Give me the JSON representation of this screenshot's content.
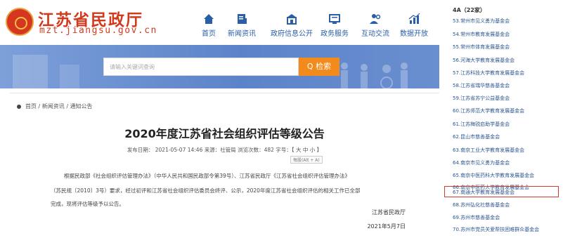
{
  "header": {
    "site_name": "江苏省民政厅",
    "site_url": "mzt.jiangsu.gov.cn",
    "nav": [
      {
        "label": "首页",
        "icon": "home-icon"
      },
      {
        "label": "新闻资讯",
        "icon": "news-icon"
      },
      {
        "label": "政府信息公开",
        "icon": "building-icon"
      },
      {
        "label": "政务服务",
        "icon": "monitor-icon"
      },
      {
        "label": "互动交流",
        "icon": "people-icon"
      },
      {
        "label": "数据开放",
        "icon": "chart-icon"
      }
    ]
  },
  "search": {
    "placeholder": "请输入关键词查询",
    "button_label": "Q 检索"
  },
  "breadcrumb": "首页 / 新闻资讯 / 通知公告",
  "article": {
    "title": "2020年度江苏省社会组织评估等级公告",
    "meta": "发布日期： 2021-05-07 14:46  来源：社管局   浏览次数：482   字号：【 大 中 小 】",
    "tooltip": "每股(Alt + A)",
    "paragraph_lines": [
      "根据民政部《社会组织评估管理办法》（中华人民共和国民政部令第39号）、江苏省民政厅《江苏省社会组织评估管理办法》",
      "（苏民规〔2010〕3号）要求，经过初评和江苏省社会组织评估委员会终评、公示，2020年度江苏省社会组织评估的相关工作已全部",
      "完成，现将评估等级予以公告。"
    ],
    "signature_org": "江苏省民政厅",
    "signature_date": "2021年5月7日"
  },
  "sidebar": {
    "heading": "4A（22家）",
    "items": [
      "53.常州市见义勇为基金会",
      "54.常州市教育发展基金会",
      "55.常州市体育发展基金会",
      "56.河海大学教育发展基金会",
      "57.江苏科技大学教育发展基金会",
      "58.江苏省瑞华慈善基金会",
      "59.江苏省苏宁公益基金会",
      "60.江苏师范大学教育发展基金会",
      "61.江苏梅锐启助学基金会",
      "62.昆山市慈善基金会",
      "63.南京工业大学教育发展基金会",
      "64.南京市见义勇为基金会",
      "65.南京中医药科大学教育发展基金会",
      "66.南京中医药大学教育发展基金会",
      "67.南通大学教育发展基金会",
      "68.苏州弘化社慈善基金会",
      "69.苏州市慈善基金会",
      "70.苏州市党员关爱帮扶困难群众基金会"
    ],
    "highlighted_index": 14,
    "highlight_color": "#d93a2a"
  },
  "colors": {
    "brand_red": "#d23a1e",
    "nav_blue": "#2a5fa6",
    "search_orange": "#f28a1c",
    "banner_blue": "#5c83c9"
  }
}
